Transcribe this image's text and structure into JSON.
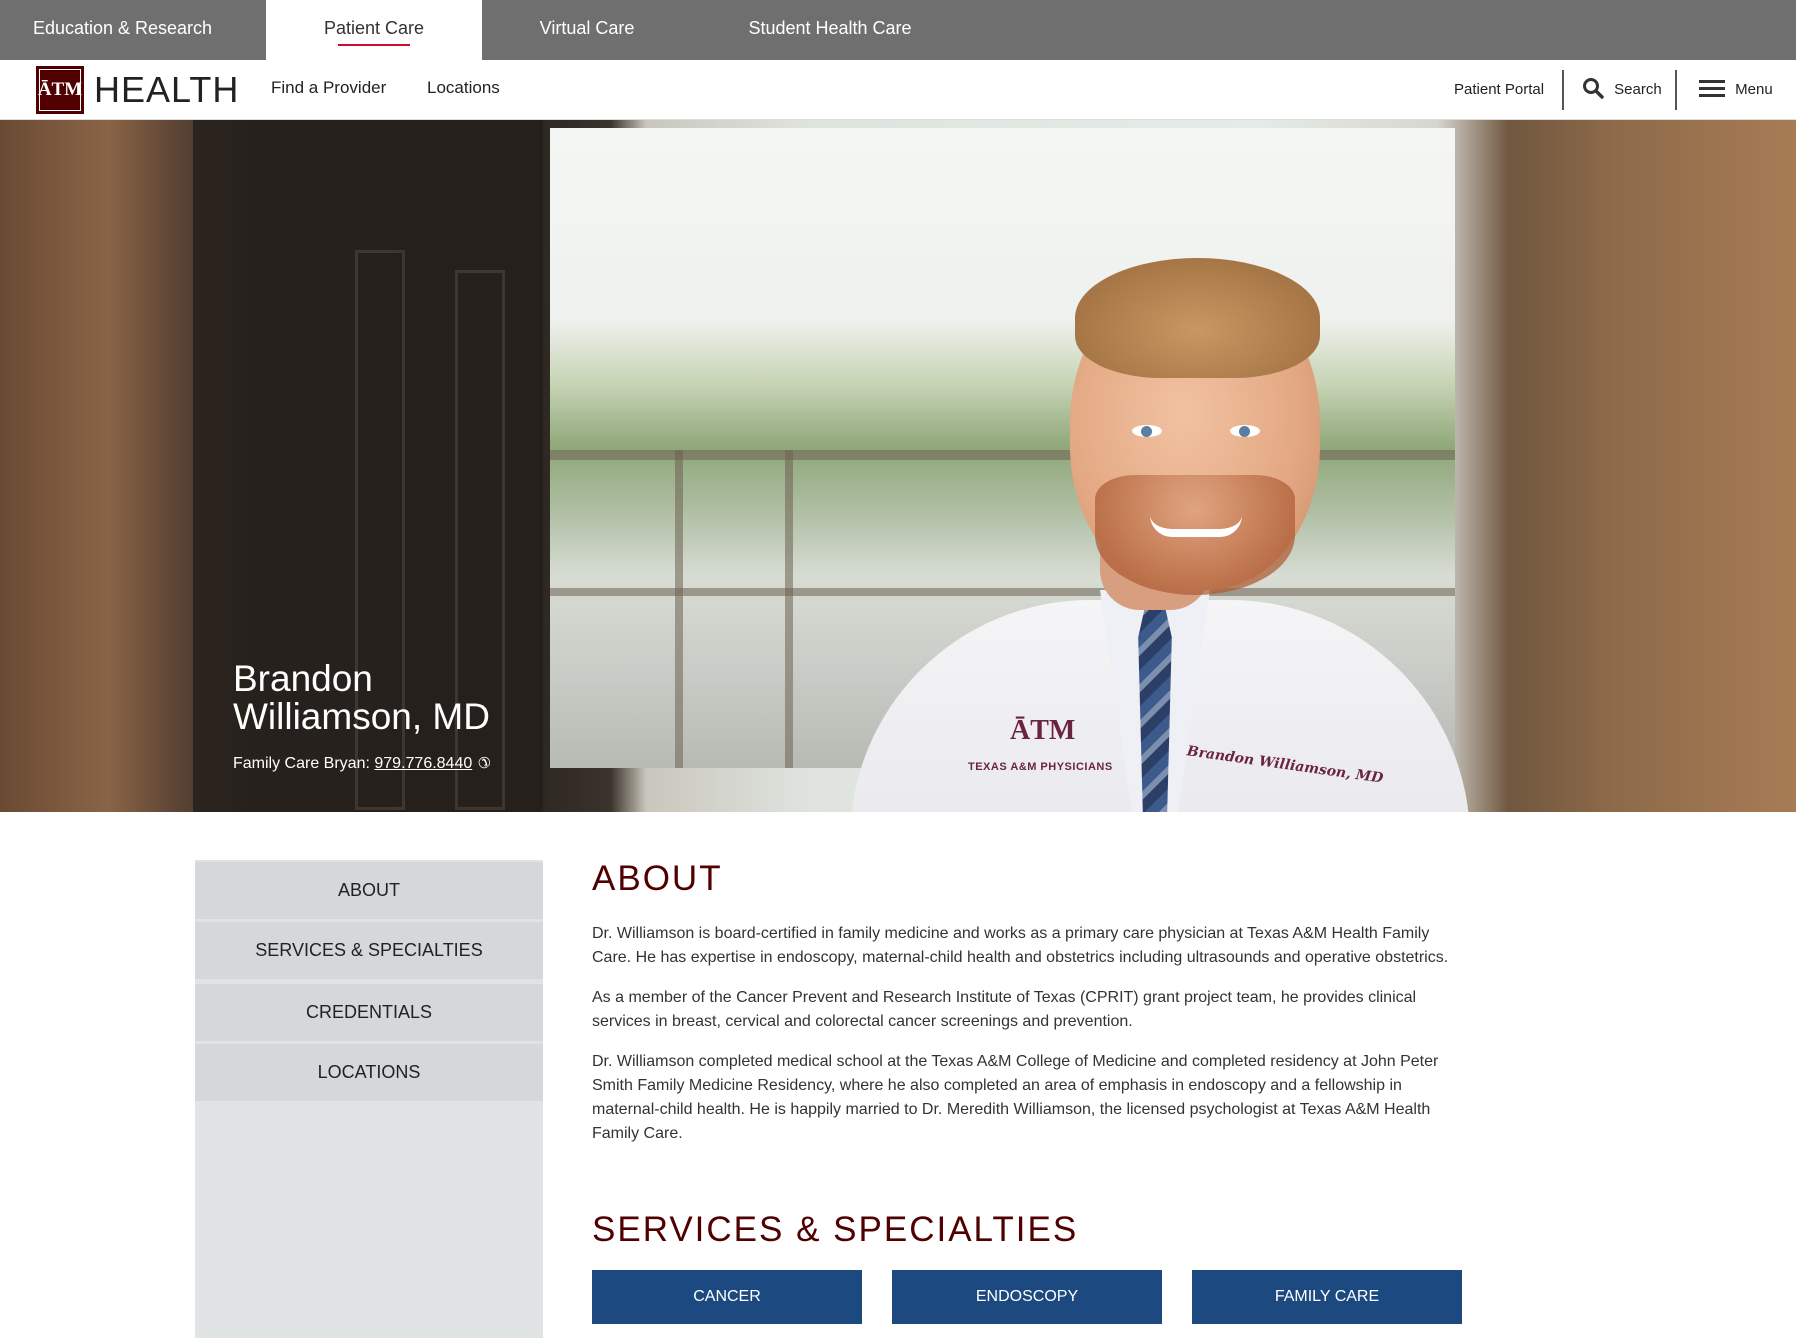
{
  "topbar": {
    "tabs": [
      {
        "label": "Education & Research",
        "active": false
      },
      {
        "label": "Patient Care",
        "active": true
      },
      {
        "label": "Virtual Care",
        "active": false
      },
      {
        "label": "Student Health Care",
        "active": false
      }
    ]
  },
  "brand": {
    "logo_mark": "ĀTM",
    "wordmark": "HEALTH",
    "colors": {
      "maroon": "#500000",
      "topbar": "#6f6f6f",
      "accent_red": "#c8102e",
      "button_blue": "#1c4a80"
    }
  },
  "mainnav": {
    "links": [
      "Find a Provider",
      "Locations"
    ],
    "patient_portal": "Patient Portal",
    "search_label": "Search",
    "menu_label": "Menu",
    "icons": {
      "search": "search-icon",
      "menu": "hamburger-menu-icon"
    }
  },
  "hero": {
    "name_line1": "Brandon",
    "name_line2": "Williamson, MD",
    "location_label": "Family Care Bryan:",
    "phone": "979.776.8440",
    "phone_icon": "phone-icon",
    "coat_logo": "ĀTM",
    "coat_text": "TEXAS A&M PHYSICIANS",
    "coat_signature": "Brandon Williamson, MD"
  },
  "sidebar": {
    "items": [
      "ABOUT",
      "SERVICES & SPECIALTIES",
      "CREDENTIALS",
      "LOCATIONS"
    ]
  },
  "about": {
    "heading": "ABOUT",
    "paragraphs": [
      "Dr. Williamson is board-certified in family medicine and works as a primary care physician at Texas A&M Health Family Care. He has expertise in endoscopy, maternal-child health and obstetrics including ultrasounds and operative obstetrics.",
      "As a member of the Cancer Prevent and Research Institute of Texas (CPRIT) grant project team, he provides clinical services in breast, cervical and colorectal cancer screenings and prevention.",
      "Dr. Williamson completed medical school at the Texas A&M College of Medicine and completed residency at John Peter Smith Family Medicine Residency, where he also completed an area of emphasis in endoscopy and a fellowship in maternal-child health. He is happily married to Dr. Meredith Williamson, the licensed psychologist at Texas A&M Health Family Care."
    ]
  },
  "services": {
    "heading": "SERVICES & SPECIALTIES",
    "buttons": [
      "CANCER",
      "ENDOSCOPY",
      "FAMILY CARE"
    ]
  }
}
